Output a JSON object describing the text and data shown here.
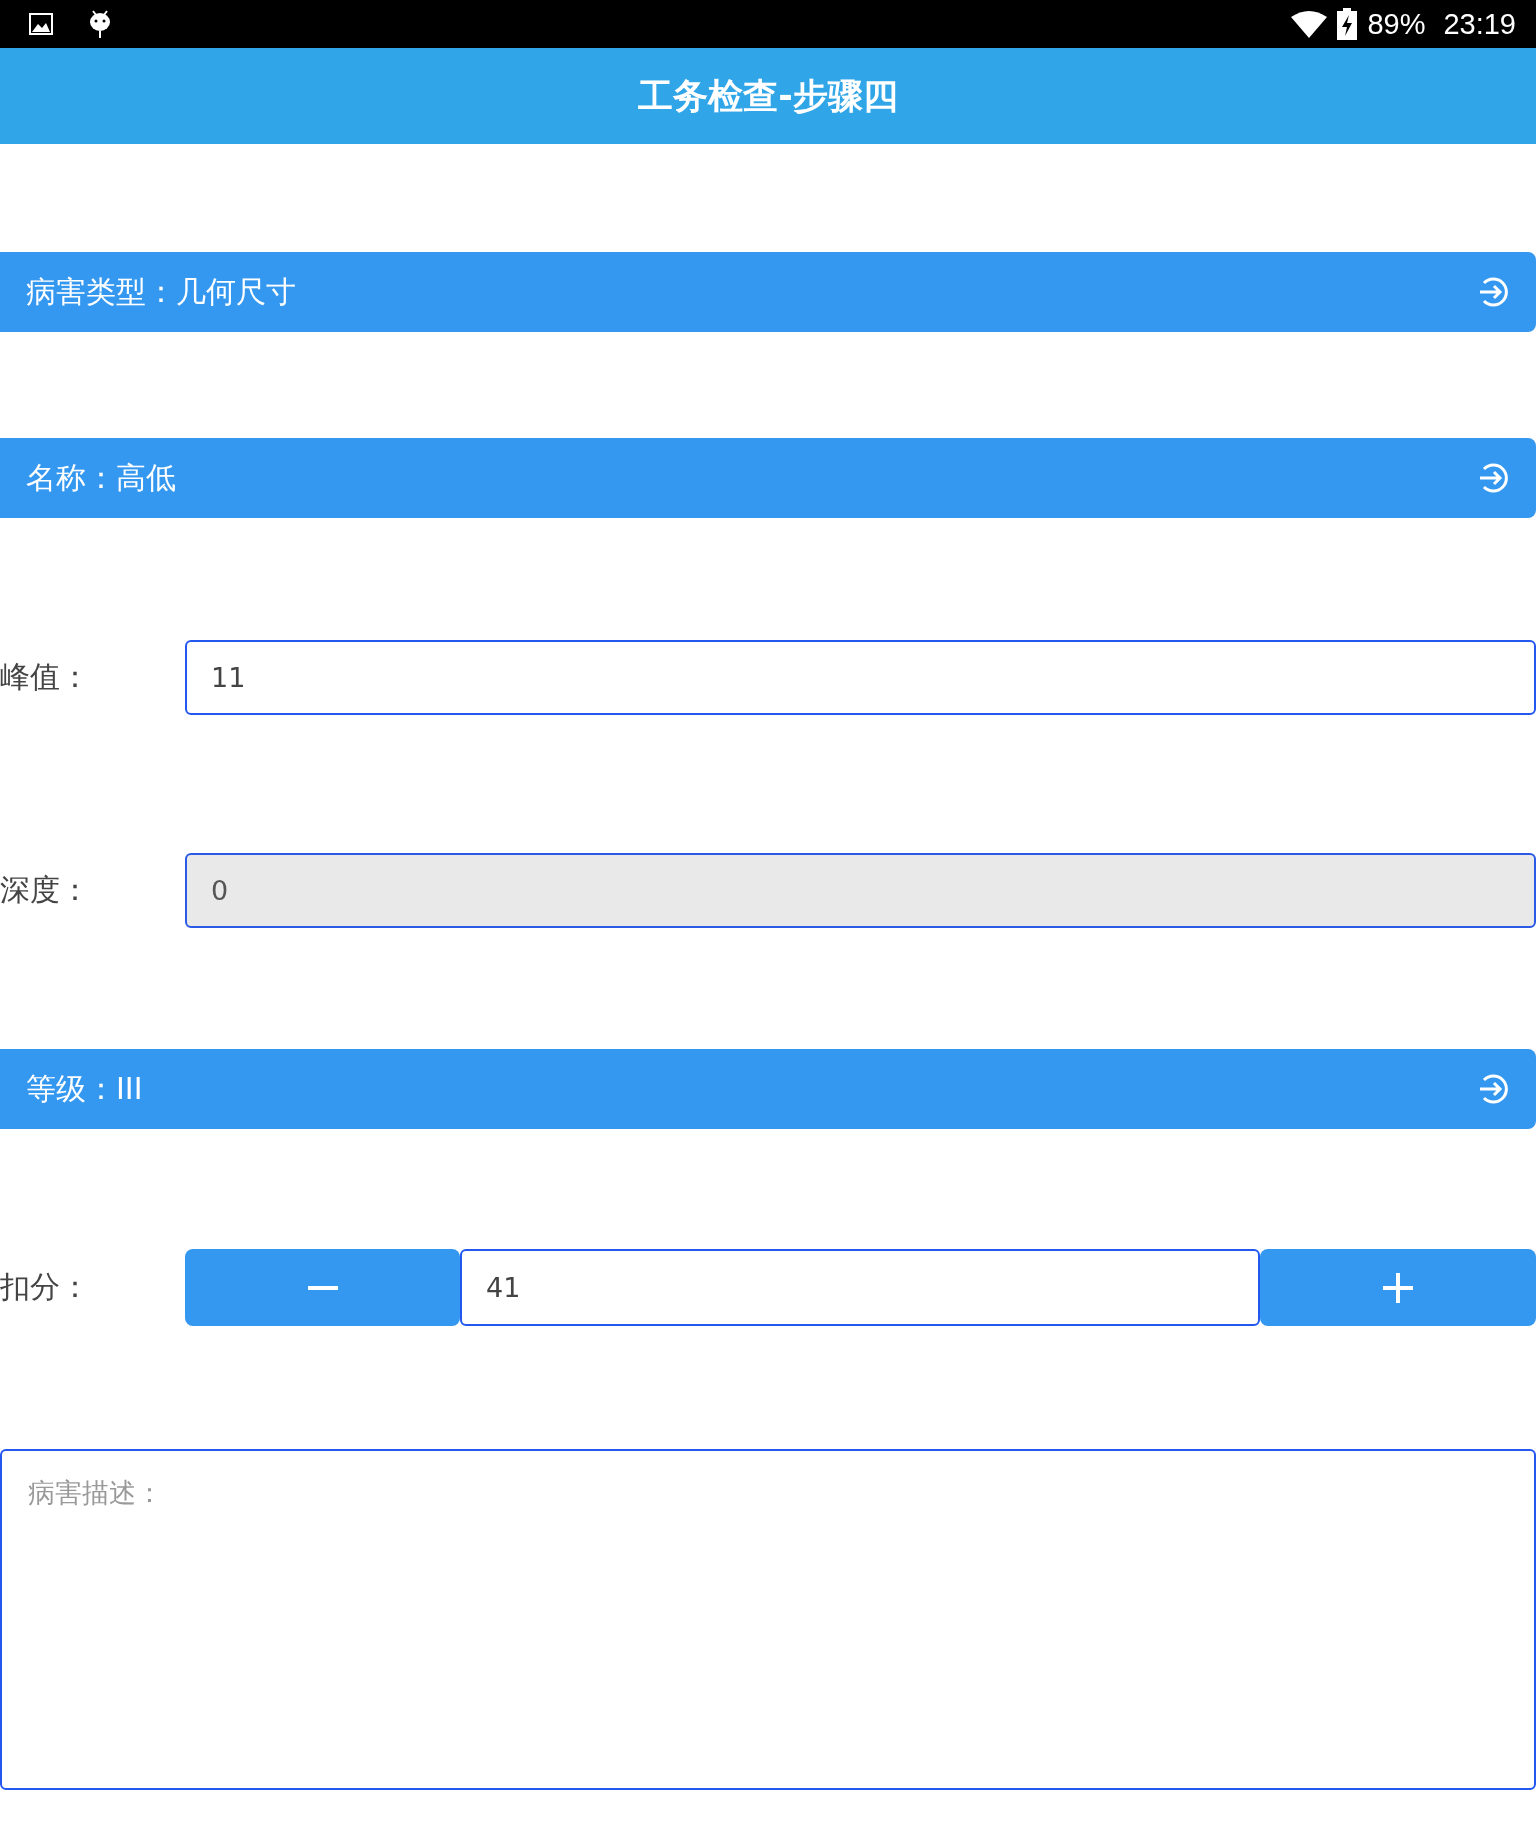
{
  "status_bar": {
    "battery": "89%",
    "time": "23:19"
  },
  "header": {
    "title": "工务检查-步骤四"
  },
  "form": [
    {
      "kind": "select",
      "label": "病害类型：几何尺寸"
    },
    {
      "kind": "select",
      "label": "名称：高低"
    },
    {
      "kind": "field",
      "label": "峰值：",
      "value": "11",
      "disabled": false
    },
    {
      "kind": "field",
      "label": "深度：",
      "value": "0",
      "disabled": true
    },
    {
      "kind": "select",
      "label": "等级：III"
    },
    {
      "kind": "stepper",
      "label": "扣分：",
      "value": "41"
    },
    {
      "kind": "textarea",
      "placeholder": "病害描述："
    }
  ]
}
